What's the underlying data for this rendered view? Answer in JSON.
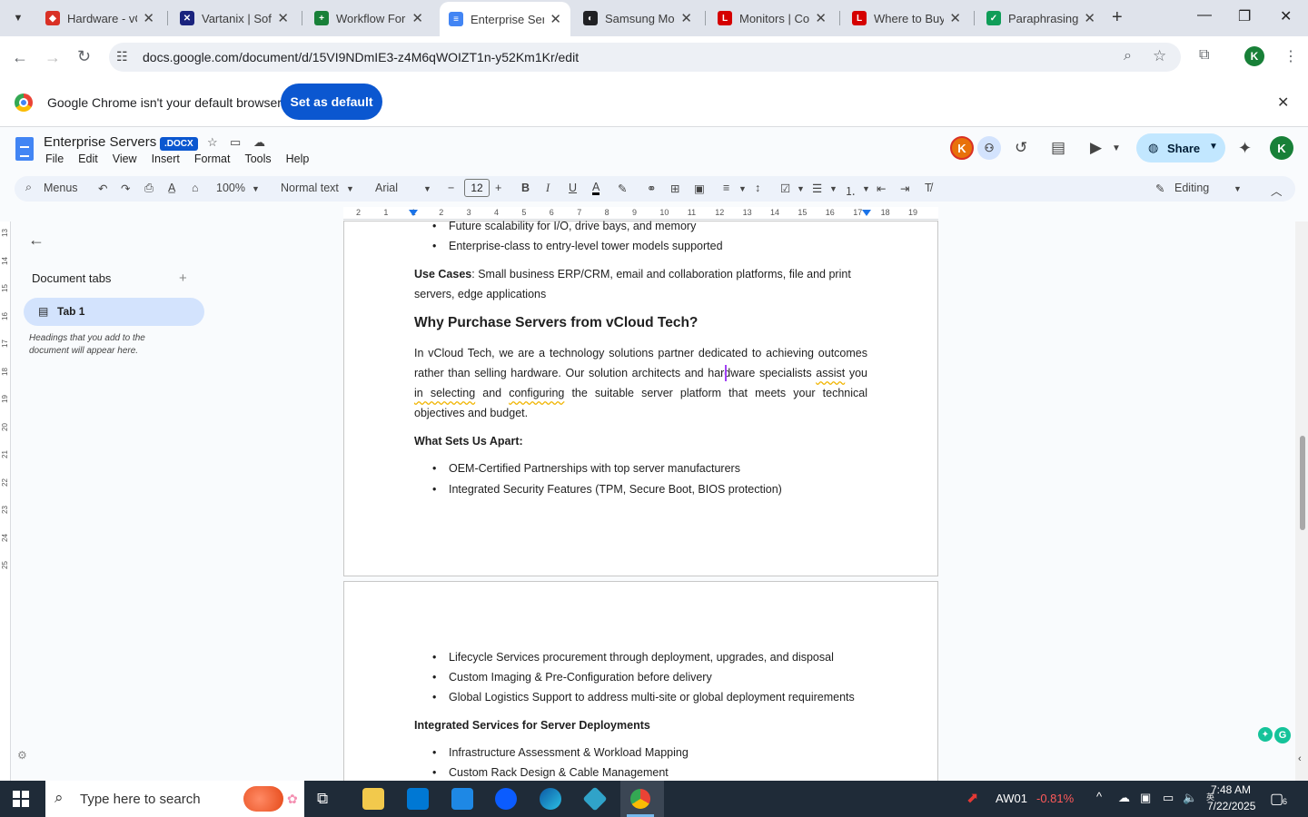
{
  "browser": {
    "tabs": [
      {
        "title": "Hardware - vC",
        "color": "#d93025",
        "glyph": "◆"
      },
      {
        "title": "Vartanix | Softv",
        "color": "#1a237e",
        "glyph": "✕"
      },
      {
        "title": "Workflow For",
        "color": "#188038",
        "glyph": "+"
      },
      {
        "title": "Enterprise Ser",
        "color": "#4285f4",
        "glyph": "≡"
      },
      {
        "title": "Samsung Mon",
        "color": "#202124",
        "glyph": "◐"
      },
      {
        "title": "Monitors | Co",
        "color": "#d50000",
        "glyph": "L"
      },
      {
        "title": "Where to Buy",
        "color": "#d50000",
        "glyph": "L"
      },
      {
        "title": "Paraphrasing T",
        "color": "#0f9d58",
        "glyph": "✓"
      }
    ],
    "url": "docs.google.com/document/d/15VI9NDmIE3-z4M6qWOIZT1n-y52Km1Kr/edit",
    "profile_initial": "K"
  },
  "infobar": {
    "message": "Google Chrome isn't your default browser",
    "button": "Set as default"
  },
  "docs": {
    "title": "Enterprise Servers",
    "badge": ".DOCX",
    "menu": [
      "File",
      "Edit",
      "View",
      "Insert",
      "Format",
      "Tools",
      "Help"
    ],
    "share_label": "Share",
    "user_initial": "K",
    "toolbar": {
      "menus_label": "Menus",
      "zoom": "100%",
      "style": "Normal text",
      "font": "Arial",
      "font_size": "12",
      "mode": "Editing"
    },
    "ruler_numbers": [
      "2",
      "1",
      "1",
      "2",
      "3",
      "4",
      "5",
      "6",
      "7",
      "8",
      "9",
      "10",
      "11",
      "12",
      "13",
      "14",
      "15",
      "16",
      "17",
      "18",
      "19"
    ],
    "vruler_numbers": [
      "13",
      "14",
      "15",
      "16",
      "17",
      "18",
      "19",
      "20",
      "21",
      "22",
      "23",
      "24",
      "25"
    ]
  },
  "sidebar": {
    "heading": "Document tabs",
    "tab_label": "Tab 1",
    "hint": "Headings that you add to the document will appear here."
  },
  "content": {
    "page1": {
      "bullets_top": [
        "Future scalability for I/O, drive bays, and memory",
        "Enterprise-class to entry-level tower models supported"
      ],
      "use_cases_label": "Use Cases",
      "use_cases_line1": ": Small business ERP/CRM, email and collaboration platforms, file and print",
      "use_cases_line2": "servers, edge applications",
      "heading": "Why Purchase Servers from vCloud Tech?",
      "para_line1": "In vCloud Tech, we are a technology solutions partner dedicated to achieving outcomes",
      "para_line2a": "rather than selling hardware. Our solution architects and hardware specialists ",
      "para_line2b": "assist",
      "para_line2c": " you",
      "para_line3a": "in selecting",
      "para_line3b": " and ",
      "para_line3c": "configuring",
      "para_line3d": " the suitable server platform that meets your technical",
      "para_line4": "objectives and budget.",
      "apart_heading": "What Sets Us Apart:",
      "apart_bullets": [
        "OEM-Certified Partnerships with top server manufacturers",
        "Integrated Security Features (TPM, Secure Boot, BIOS protection)"
      ]
    },
    "page2": {
      "bullets": [
        "Lifecycle Services procurement through deployment, upgrades, and disposal",
        "Custom Imaging & Pre-Configuration before delivery",
        "Global Logistics Support to address multi-site or global deployment requirements"
      ],
      "heading": "Integrated Services for Server Deployments",
      "bullets2": [
        "Infrastructure Assessment & Workload Mapping",
        "Custom Rack Design & Cable Management"
      ]
    }
  },
  "taskbar": {
    "search_placeholder": "Type here to search",
    "stock_symbol": "AW01",
    "stock_change": "-0.81%",
    "time": "7:48 AM",
    "date": "7/22/2025",
    "notification_count": "6"
  }
}
